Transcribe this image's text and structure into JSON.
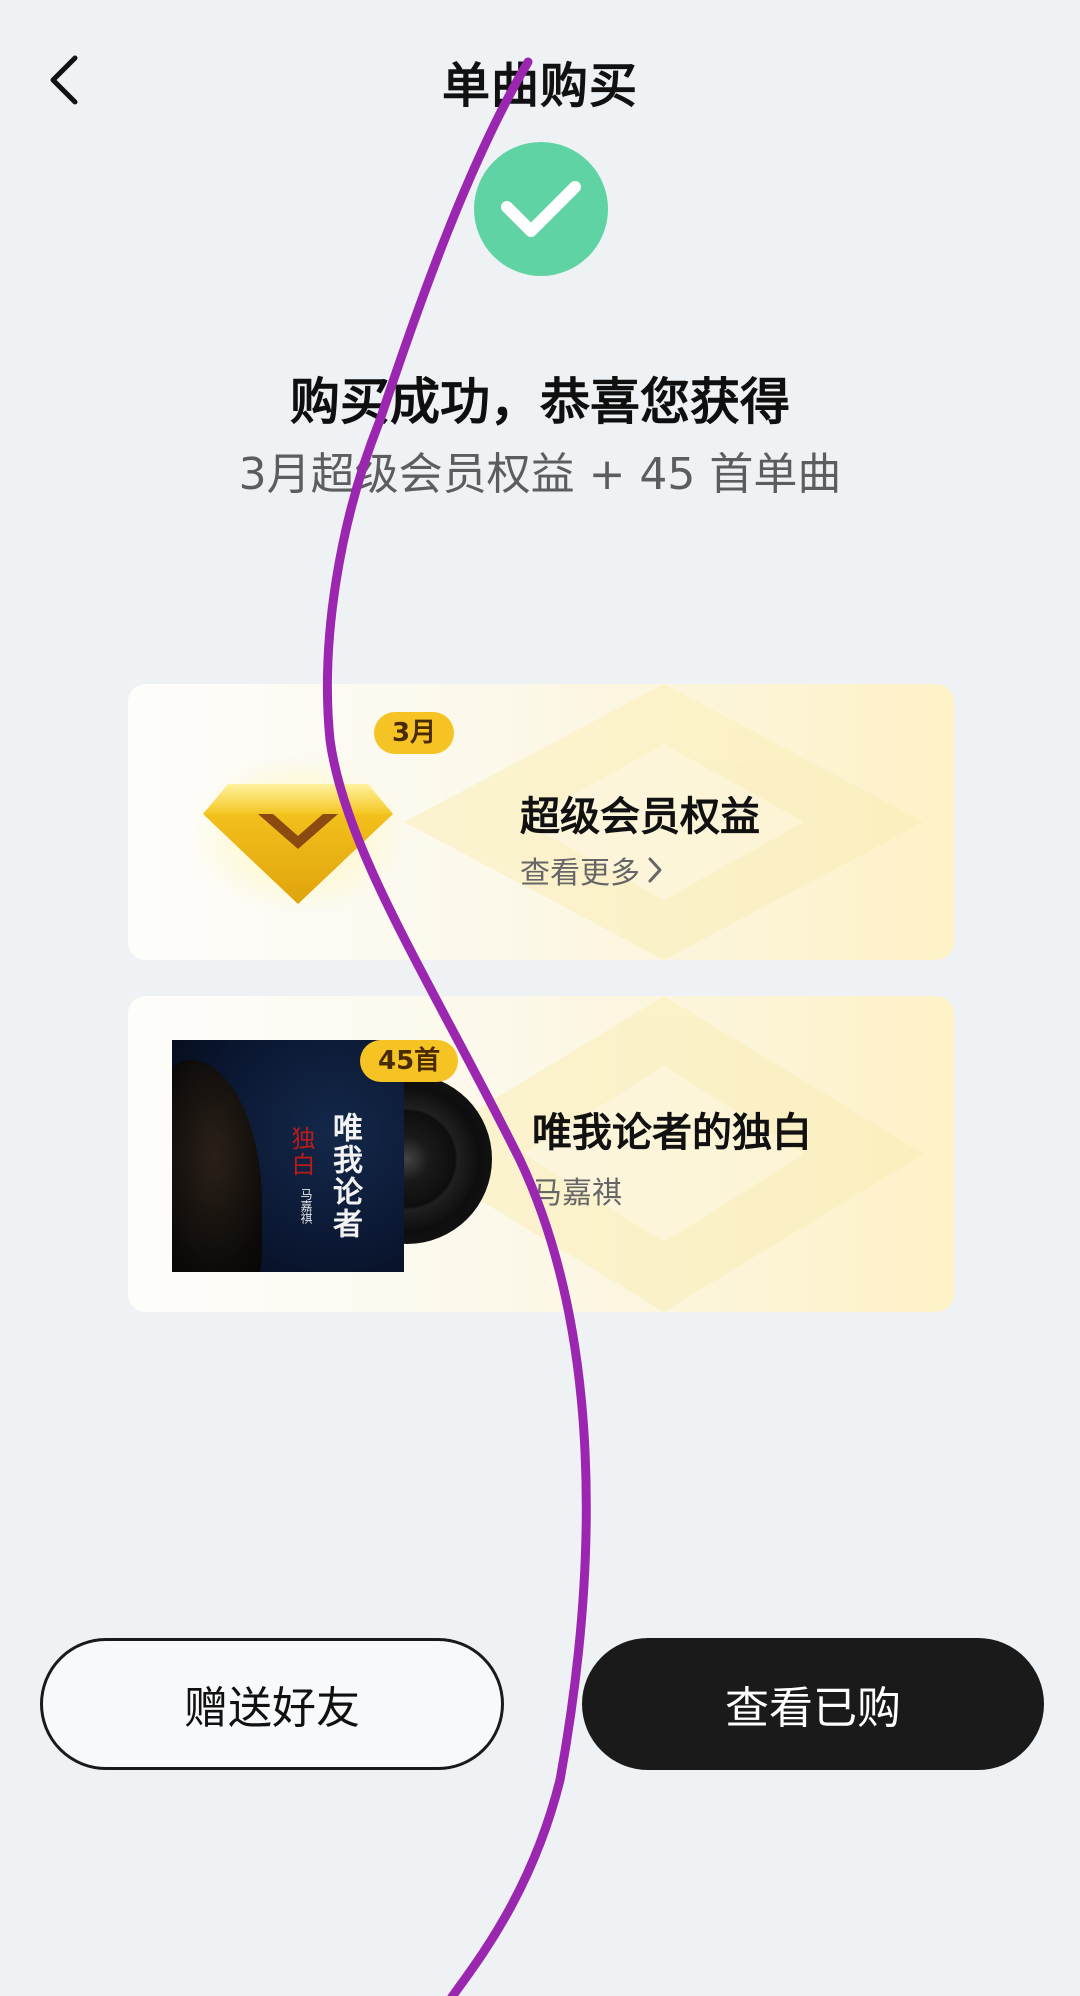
{
  "header": {
    "back_icon": "chevron-left-icon",
    "title": "单曲购买"
  },
  "success": {
    "icon": "check-icon",
    "icon_color": "#5fd3a4",
    "title": "购买成功，恭喜您获得",
    "subtitle": "3月超级会员权益 + 45 首单曲"
  },
  "vip_card": {
    "icon": "diamond-icon",
    "badge": "3月",
    "title": "超级会员权益",
    "link_label": "查看更多",
    "link_icon": "chevron-right-icon"
  },
  "song_card": {
    "badge": "45首",
    "title": "唯我论者的独白",
    "artist": "马嘉祺",
    "cover": {
      "title_text": "唯我论者",
      "side_text": "独白",
      "artist_text": "马嘉祺"
    }
  },
  "buttons": {
    "gift_label": "赠送好友",
    "view_label": "查看已购"
  },
  "colors": {
    "badge": "#f6c324",
    "primary_button": "#1a1a1a",
    "background": "#eef2f5",
    "overlay_stroke": "#9b27b0"
  }
}
